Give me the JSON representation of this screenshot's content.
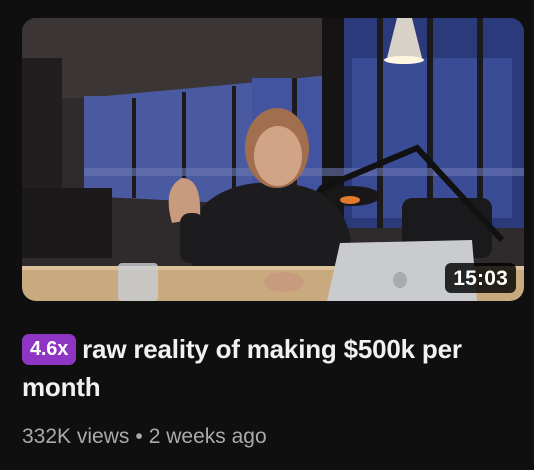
{
  "video": {
    "duration": "15:03",
    "speed_badge": "4.6x",
    "title": "raw reality of making $500k per month",
    "views": "332K views",
    "separator": "•",
    "age": "2 weeks ago"
  },
  "icons": {
    "thumbnail": "video-thumbnail-image"
  },
  "colors": {
    "background": "#0f0f0f",
    "badge": "#8e35c4",
    "title": "#f1f1f1",
    "meta": "#aaaaaa"
  }
}
